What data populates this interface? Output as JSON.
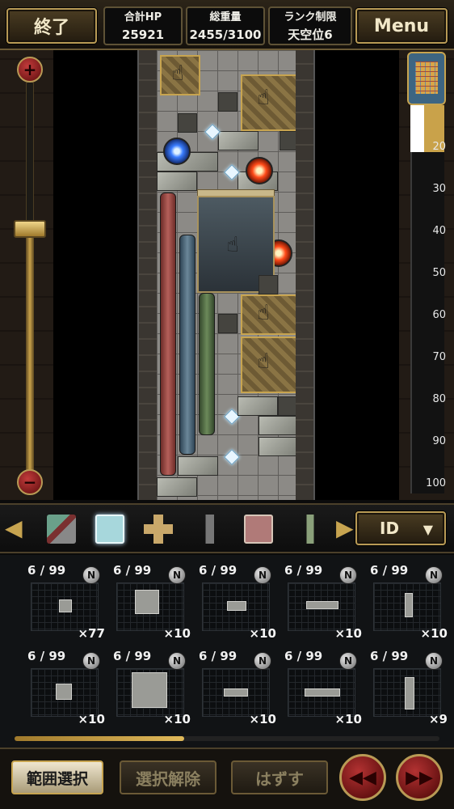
{
  "header": {
    "end_label": "終了",
    "menu_label": "Menu",
    "stats": {
      "hp_label": "合計HP",
      "hp_value": "25921",
      "weight_label": "総重量",
      "weight_value": "2455/3100",
      "rank_label": "ランク制限",
      "rank_value": "天空位6"
    }
  },
  "zoom": {
    "plus": "+",
    "minus": "−",
    "level": 0.4
  },
  "ruler": {
    "ticks": [
      "20",
      "30",
      "40",
      "50",
      "60",
      "70",
      "80",
      "90",
      "100"
    ]
  },
  "palette": {
    "left_arrow": "◀",
    "right_arrow": "▶",
    "sort_label": "ID",
    "sort_caret": "▼",
    "selected_index": 1
  },
  "grid": {
    "rows": [
      [
        {
          "count": "6 / 99",
          "badge": "N",
          "qty": "×77"
        },
        {
          "count": "6 / 99",
          "badge": "N",
          "qty": "×10"
        },
        {
          "count": "6 / 99",
          "badge": "N",
          "qty": "×10"
        },
        {
          "count": "6 / 99",
          "badge": "N",
          "qty": "×10"
        },
        {
          "count": "6 / 99",
          "badge": "N",
          "qty": "×10"
        }
      ],
      [
        {
          "count": "6 / 99",
          "badge": "N",
          "qty": "×10"
        },
        {
          "count": "6 / 99",
          "badge": "N",
          "qty": "×10"
        },
        {
          "count": "6 / 99",
          "badge": "N",
          "qty": "×10"
        },
        {
          "count": "6 / 99",
          "badge": "N",
          "qty": "×10"
        },
        {
          "count": "6 / 99",
          "badge": "N",
          "qty": "×9"
        }
      ]
    ],
    "scroll_progress": 0.4
  },
  "bottom": {
    "range_select": "範囲選択",
    "deselect": "選択解除",
    "remove": "はずす",
    "rewind": "◀◀",
    "fast_forward": "▶▶"
  },
  "colors": {
    "accent_gold": "#c7a450",
    "selected_tile": "#a7d7dc"
  }
}
